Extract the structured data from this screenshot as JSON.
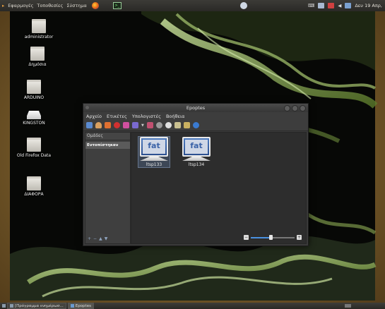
{
  "topbar": {
    "menus": [
      "Εφαρμογές",
      "Τοποθεσίες",
      "Σύστημα"
    ],
    "clock": "Δευ 19 Απρ,"
  },
  "desktop_icons": [
    {
      "label": "administrator",
      "icon": "home-folder-icon"
    },
    {
      "label": "Δημόσια",
      "icon": "public-folder-icon"
    },
    {
      "label": "ARDUINO",
      "icon": "folder-icon"
    },
    {
      "label": "KINGSTON",
      "icon": "usb-drive-icon"
    },
    {
      "label": "Old Firefox Data",
      "icon": "folder-icon"
    },
    {
      "label": "ΔΙΑΦΟΡΑ",
      "icon": "folder-icon"
    }
  ],
  "window": {
    "title": "Epoptes",
    "menu": [
      "Αρχείο",
      "Ετικέτες",
      "Υπολογιστές",
      "Βοήθεια"
    ],
    "sidebar_header": "Ομάδες",
    "groups": [
      "Εντοπίστηκαν"
    ],
    "clients": [
      {
        "name": "ltsp133",
        "screen_text": "fat"
      },
      {
        "name": "ltsp134",
        "screen_text": "fat"
      }
    ],
    "zoom_level": 0.45
  },
  "taskbar": {
    "items": [
      "[Πρόγραμμα ενημέρωσ...",
      "Epoptes"
    ]
  }
}
